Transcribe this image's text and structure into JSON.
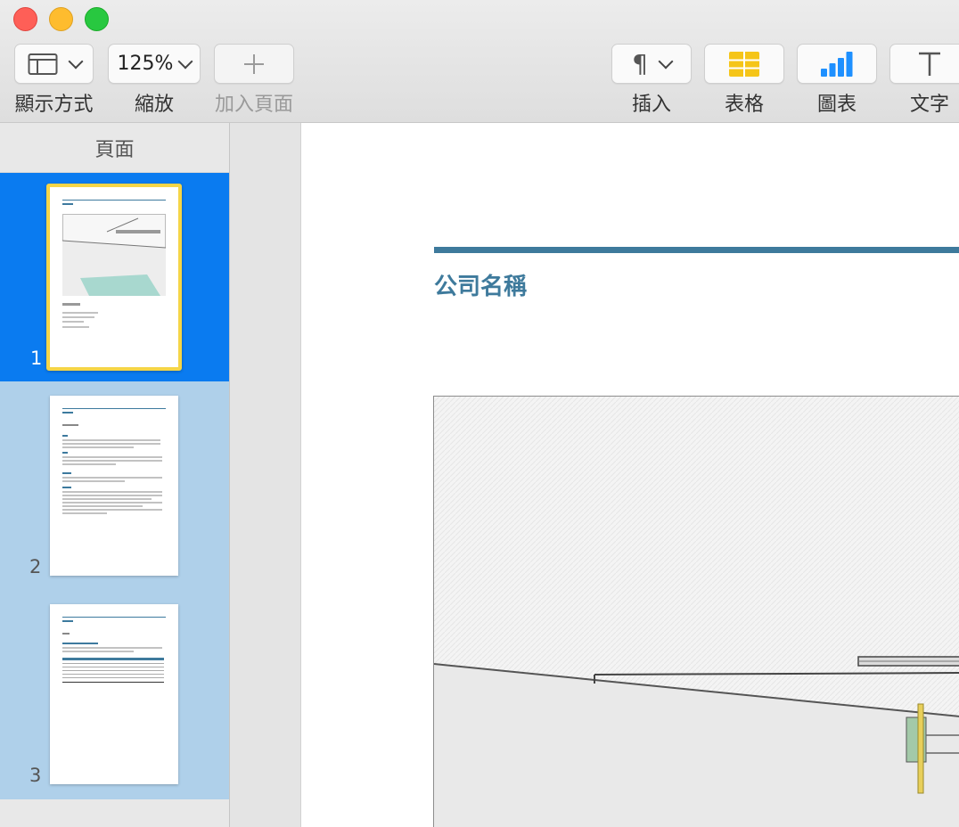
{
  "toolbar": {
    "view_label": "顯示方式",
    "zoom_value": "125%",
    "zoom_label": "縮放",
    "add_page_label": "加入頁面",
    "insert_label": "插入",
    "table_label": "表格",
    "chart_label": "圖表",
    "text_label": "文字"
  },
  "sidebar": {
    "title": "頁面",
    "pages": [
      {
        "number": "1",
        "selected": true
      },
      {
        "number": "2",
        "selected": false
      },
      {
        "number": "3",
        "selected": false
      }
    ]
  },
  "document": {
    "company_name": "公司名稱"
  },
  "colors": {
    "accent": "#3e7a9c",
    "selection": "#0a7bf0",
    "sidebar_bg": "#afd0ea",
    "active_border": "#f5d547"
  }
}
